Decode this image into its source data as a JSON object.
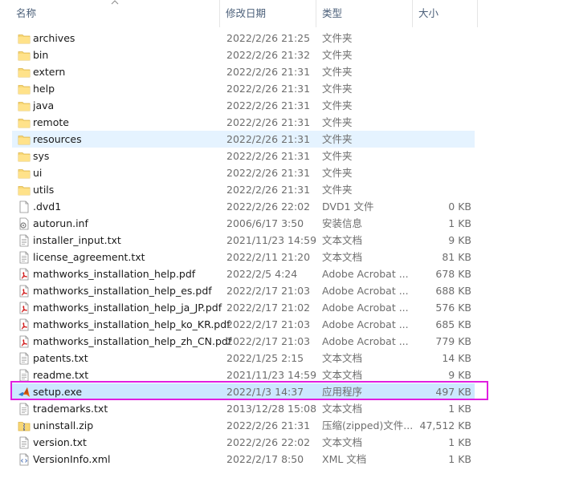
{
  "columns": {
    "name": "名称",
    "date": "修改日期",
    "type": "类型",
    "size": "大小"
  },
  "files": [
    {
      "name": "archives",
      "date": "2022/2/26 21:25",
      "type": "文件夹",
      "size": "",
      "icon": "folder-icon"
    },
    {
      "name": "bin",
      "date": "2022/2/26 21:32",
      "type": "文件夹",
      "size": "",
      "icon": "folder-icon"
    },
    {
      "name": "extern",
      "date": "2022/2/26 21:31",
      "type": "文件夹",
      "size": "",
      "icon": "folder-icon"
    },
    {
      "name": "help",
      "date": "2022/2/26 21:31",
      "type": "文件夹",
      "size": "",
      "icon": "folder-icon"
    },
    {
      "name": "java",
      "date": "2022/2/26 21:31",
      "type": "文件夹",
      "size": "",
      "icon": "folder-icon"
    },
    {
      "name": "remote",
      "date": "2022/2/26 21:31",
      "type": "文件夹",
      "size": "",
      "icon": "folder-icon"
    },
    {
      "name": "resources",
      "date": "2022/2/26 21:31",
      "type": "文件夹",
      "size": "",
      "icon": "folder-icon"
    },
    {
      "name": "sys",
      "date": "2022/2/26 21:31",
      "type": "文件夹",
      "size": "",
      "icon": "folder-icon"
    },
    {
      "name": "ui",
      "date": "2022/2/26 21:31",
      "type": "文件夹",
      "size": "",
      "icon": "folder-icon"
    },
    {
      "name": "utils",
      "date": "2022/2/26 21:31",
      "type": "文件夹",
      "size": "",
      "icon": "folder-icon"
    },
    {
      "name": ".dvd1",
      "date": "2022/2/26 22:02",
      "type": "DVD1 文件",
      "size": "0 KB",
      "icon": "file-icon"
    },
    {
      "name": "autorun.inf",
      "date": "2006/6/17 3:50",
      "type": "安装信息",
      "size": "1 KB",
      "icon": "settings-file-icon"
    },
    {
      "name": "installer_input.txt",
      "date": "2021/11/23 14:59",
      "type": "文本文档",
      "size": "9 KB",
      "icon": "text-file-icon"
    },
    {
      "name": "license_agreement.txt",
      "date": "2022/2/11 21:20",
      "type": "文本文档",
      "size": "81 KB",
      "icon": "text-file-icon"
    },
    {
      "name": "mathworks_installation_help.pdf",
      "date": "2022/2/5 4:24",
      "type": "Adobe Acrobat ...",
      "size": "678 KB",
      "icon": "pdf-icon"
    },
    {
      "name": "mathworks_installation_help_es.pdf",
      "date": "2022/2/17 21:03",
      "type": "Adobe Acrobat ...",
      "size": "688 KB",
      "icon": "pdf-icon"
    },
    {
      "name": "mathworks_installation_help_ja_JP.pdf",
      "date": "2022/2/17 21:02",
      "type": "Adobe Acrobat ...",
      "size": "576 KB",
      "icon": "pdf-icon"
    },
    {
      "name": "mathworks_installation_help_ko_KR.pdf",
      "date": "2022/2/17 21:03",
      "type": "Adobe Acrobat ...",
      "size": "685 KB",
      "icon": "pdf-icon"
    },
    {
      "name": "mathworks_installation_help_zh_CN.pdf",
      "date": "2022/2/17 21:03",
      "type": "Adobe Acrobat ...",
      "size": "779 KB",
      "icon": "pdf-icon"
    },
    {
      "name": "patents.txt",
      "date": "2022/1/25 2:15",
      "type": "文本文档",
      "size": "14 KB",
      "icon": "text-file-icon"
    },
    {
      "name": "readme.txt",
      "date": "2021/11/23 14:59",
      "type": "文本文档",
      "size": "9 KB",
      "icon": "text-file-icon"
    },
    {
      "name": "setup.exe",
      "date": "2022/1/3 14:37",
      "type": "应用程序",
      "size": "497 KB",
      "icon": "matlab-icon"
    },
    {
      "name": "trademarks.txt",
      "date": "2013/12/28 15:08",
      "type": "文本文档",
      "size": "1 KB",
      "icon": "text-file-icon"
    },
    {
      "name": "uninstall.zip",
      "date": "2022/2/26 21:31",
      "type": "压缩(zipped)文件...",
      "size": "47,512 KB",
      "icon": "zip-icon"
    },
    {
      "name": "version.txt",
      "date": "2022/2/26 22:02",
      "type": "文本文档",
      "size": "1 KB",
      "icon": "text-file-icon"
    },
    {
      "name": "VersionInfo.xml",
      "date": "2022/2/17 8:50",
      "type": "XML 文档",
      "size": "1 KB",
      "icon": "xml-file-icon"
    }
  ],
  "hover_index": 6,
  "selected_index": 21,
  "highlight_color": "#e01fe0"
}
